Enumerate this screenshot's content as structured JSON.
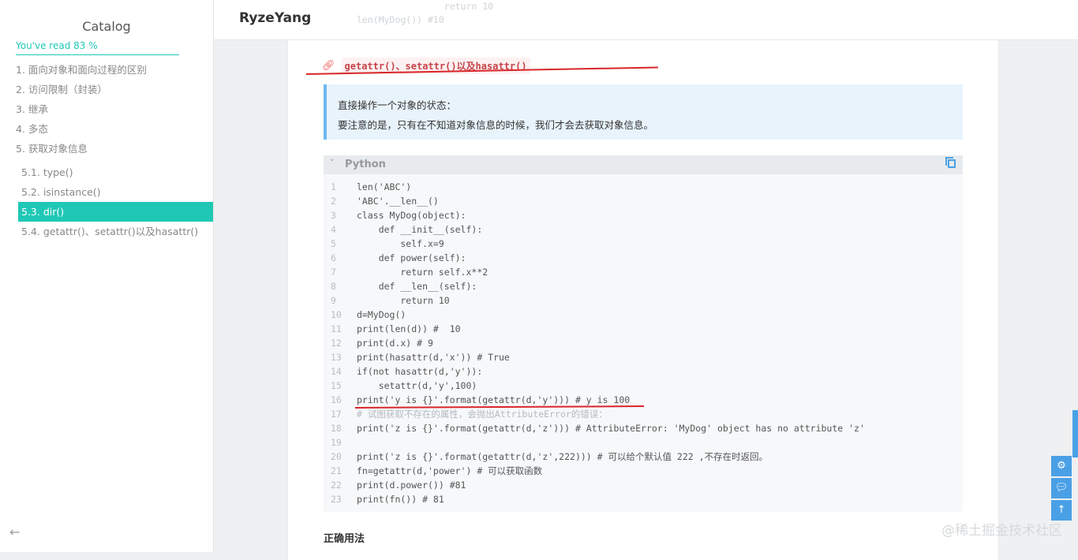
{
  "sidebar": {
    "title": "Catalog",
    "progress": "You've read  83 %",
    "items": [
      {
        "label": "1. 面向对象和面向过程的区别"
      },
      {
        "label": "2. 访问限制（封装）"
      },
      {
        "label": "3. 继承"
      },
      {
        "label": "4. 多态"
      },
      {
        "label": "5. 获取对象信息"
      },
      {
        "label": "5.1. type()"
      },
      {
        "label": "5.2. isinstance()"
      },
      {
        "label": "5.3. dir()"
      },
      {
        "label": "5.4. getattr()、setattr()以及hasattr()"
      }
    ],
    "back_icon": "arrow-left-icon"
  },
  "header": {
    "brand": "RyzeYang"
  },
  "ghost_code": [
    "                return 10",
    "len(MyDog()) #10"
  ],
  "heading": {
    "text": "getattr()、setattr()以及hasattr()"
  },
  "note": {
    "line1": "直接操作一个对象的状态：",
    "line2": "要注意的是，只有在不知道对象信息的时候，我们才会去获取对象信息。"
  },
  "code": {
    "language": "Python",
    "lines": [
      "len('ABC')",
      "'ABC'.__len__()",
      "class MyDog(object):",
      "    def __init__(self):",
      "        self.x=9",
      "    def power(self):",
      "        return self.x**2",
      "    def __len__(self):",
      "        return 10",
      "d=MyDog()",
      "print(len(d)) #  10",
      "print(d.x) # 9",
      "print(hasattr(d,'x')) # True",
      "if(not hasattr(d,'y')):",
      "    setattr(d,'y',100)",
      "print('y is {}'.format(getattr(d,'y'))) # y is 100",
      "# 试图获取不存在的属性，会抛出AttributeError的错误：",
      "print('z is {}'.format(getattr(d,'z'))) # AttributeError: 'MyDog' object has no attribute 'z'",
      "",
      "print('z is {}'.format(getattr(d,'z',222))) # 可以给个默认值 222 ,不存在时返回。",
      "fn=getattr(d,'power') # 可以获取函数",
      "print(d.power()) #81",
      "print(fn()) # 81"
    ]
  },
  "subhead": "正确用法",
  "widgets": [
    "gear-icon",
    "chat-icon",
    "arrow-up-icon"
  ],
  "watermark": "@稀土掘金技术社区",
  "colors": {
    "accent": "#1fc8b5",
    "blue": "#4aa0e6",
    "red": "#d9262a"
  }
}
